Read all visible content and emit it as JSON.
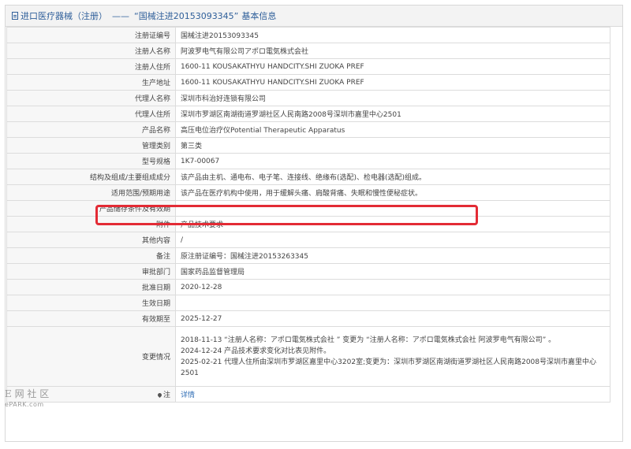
{
  "header": {
    "category": "进口医疗器械（注册）",
    "separator": "——",
    "registration_quoted": "“国械注进20153093345”",
    "suffix": "基本信息"
  },
  "rows": [
    {
      "label": "注册证编号",
      "value": "国械注进20153093345"
    },
    {
      "label": "注册人名称",
      "value": "阿波罗电气有限公司アポロ電気株式会社"
    },
    {
      "label": "注册人住所",
      "value": "1600-11 KOUSAKATHYU HANDCITY.SHI ZUOKA PREF"
    },
    {
      "label": "生产地址",
      "value": "1600-11 KOUSAKATHYU HANDCITY.SHI ZUOKA PREF"
    },
    {
      "label": "代理人名称",
      "value": "深圳市科治好连锁有限公司"
    },
    {
      "label": "代理人住所",
      "value": "深圳市罗湖区南湖街道罗湖社区人民南路2008号深圳市嘉里中心2501"
    },
    {
      "label": "产品名称",
      "value": "高压电位治疗仪Potential Therapeutic Apparatus"
    },
    {
      "label": "管理类别",
      "value": "第三类"
    },
    {
      "label": "型号规格",
      "value": "1K7-00067"
    },
    {
      "label": "结构及组成/主要组成成分",
      "value": "该产品由主机、通电布、电子笔、连接线、绝缘布(选配)、检电器(选配)组成。"
    },
    {
      "label": "适用范围/预期用途",
      "value": "该产品在医疗机构中使用，用于缓解头痛、肩酸背痛、失眠和慢性便秘症状。"
    },
    {
      "label": "产品储存条件及有效期",
      "value": ""
    },
    {
      "label": "附件",
      "value": "产品技术要求"
    },
    {
      "label": "其他内容",
      "value": "/"
    },
    {
      "label": "备注",
      "value": "原注册证编号：国械注进20153263345"
    },
    {
      "label": "审批部门",
      "value": "国家药品监督管理局"
    },
    {
      "label": "批准日期",
      "value": "2020-12-28"
    },
    {
      "label": "生效日期",
      "value": ""
    },
    {
      "label": "有效期至",
      "value": "2025-12-27"
    }
  ],
  "change_history": {
    "label": "变更情况",
    "lines": [
      "2018-11-13 “注册人名称：アポロ電気株式会社 ” 变更为 “注册人名称：アポロ電気株式会社 阿波罗电气有限公司” 。",
      "2024-12-24 产品技术要求变化对比表见附件。",
      "2025-02-21 代理人住所由深圳市罗湖区嘉里中心3202室;变更为：深圳市罗湖区南湖街道罗湖社区人民南路2008号深圳市嘉里中心2501"
    ]
  },
  "note": {
    "label": "注",
    "link": "详情"
  },
  "watermark": {
    "chars": "E 网 社 区",
    "sub": "ePARK.com"
  },
  "colors": {
    "highlight": "#e32b35",
    "link": "#2f6db5",
    "header_text": "#2f5f9a"
  }
}
